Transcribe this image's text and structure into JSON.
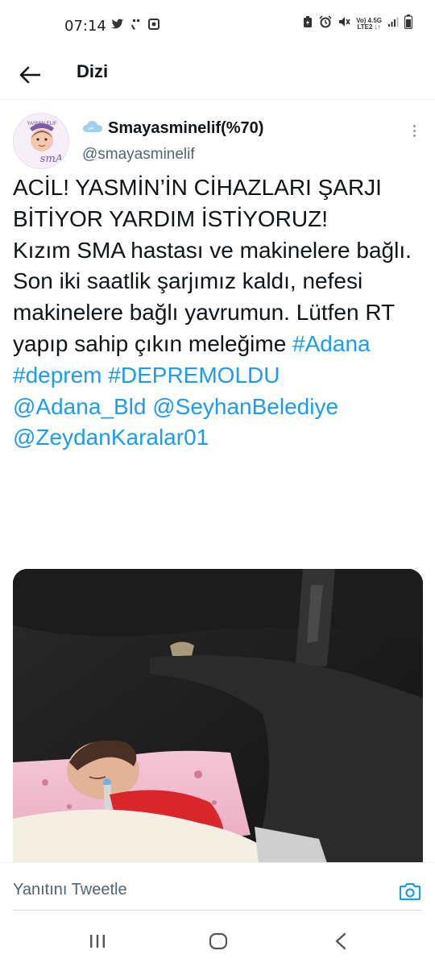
{
  "status_bar": {
    "time": "07:14",
    "left_icons": [
      "twitter-icon",
      "missed-call-icon",
      "screenshot-icon"
    ],
    "right_icons": [
      "battery-saver-icon",
      "alarm-icon",
      "mute-icon",
      "volte-icon",
      "network-4g-icon",
      "signal-icon",
      "battery-icon"
    ],
    "net_top": "Vo) 4.5G",
    "net_bottom": "LTE2 ↓↑"
  },
  "header": {
    "title": "Dizi",
    "back_icon": "arrow-left-icon"
  },
  "tweet": {
    "author": {
      "emoji_icon": "cloud-icon",
      "display_name": "Smayasminelif(%70)",
      "username": "@smayasminelif",
      "avatar_text_top": "YASMIN ELİF",
      "avatar_text_bottom": "smA"
    },
    "text_plain": "ACİL! YASMİN’İN CİHAZLARI ŞARJI BİTİYOR YARDIM İSTİYORUZ!\nKızım SMA hastası ve makinelere bağlı. Son iki saatlik şarjımız kaldı, nefesi makinelere bağlı yavrumun. Lütfen RT yapıp sahip çıkın meleğime ",
    "hashtags": [
      "#Adana",
      "#deprem",
      "#DEPREMOLDU"
    ],
    "mentions": [
      "@Adana_Bld",
      "@SeyhanBelediye",
      "@ZeydanKaralar01"
    ],
    "media_description": "photo"
  },
  "reply_bar": {
    "placeholder": "Yanıtını Tweetle",
    "camera_icon": "camera-icon"
  },
  "nav_bar": {
    "items": [
      "recent-apps-icon",
      "home-icon",
      "back-icon"
    ]
  },
  "colors": {
    "accent": "#1d9bf0",
    "text": "#0f1419",
    "secondary": "#536471"
  }
}
